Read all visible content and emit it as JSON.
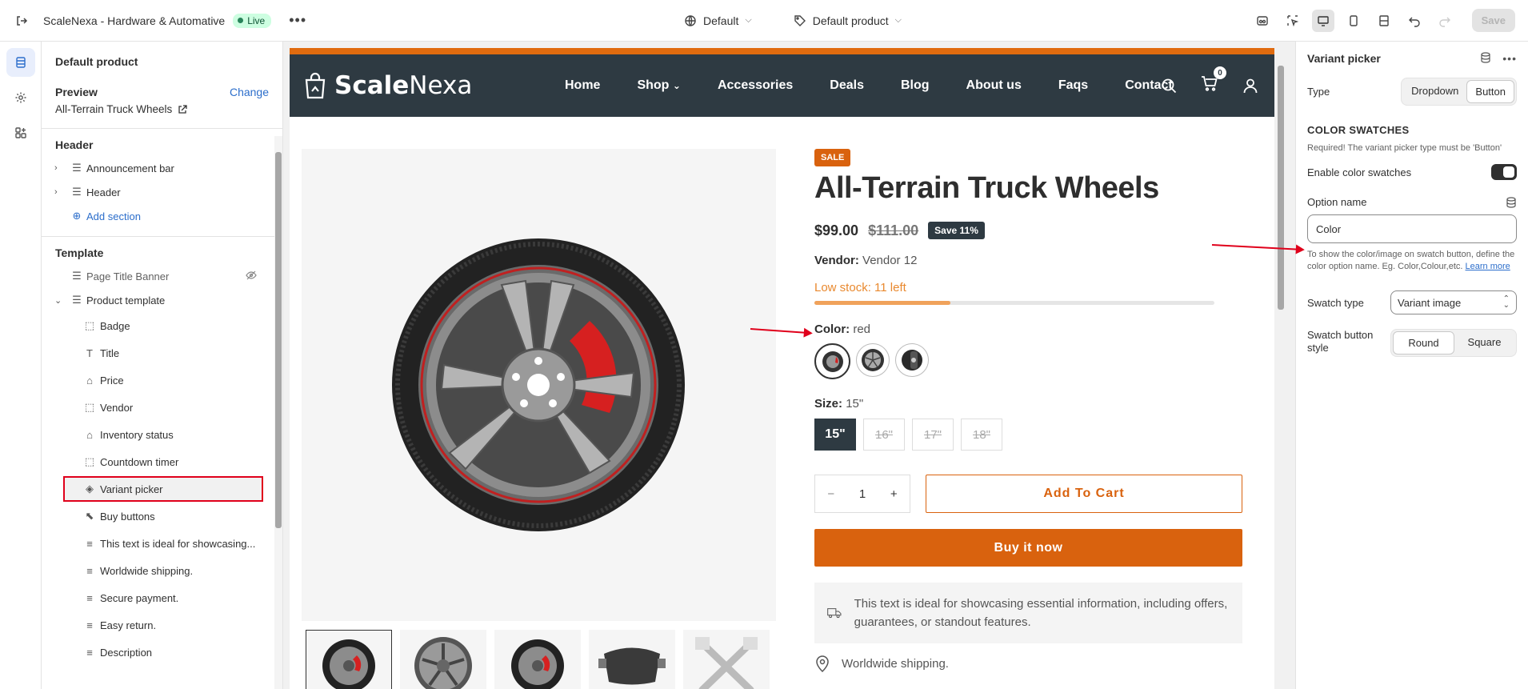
{
  "topbar": {
    "store_name": "ScaleNexa - Hardware & Automative",
    "status": "Live",
    "theme_select": "Default",
    "template_select": "Default product",
    "save_label": "Save"
  },
  "left_panel": {
    "title": "Default product",
    "preview_label": "Preview",
    "change_label": "Change",
    "preview_value": "All-Terrain Truck Wheels",
    "header_section": "Header",
    "header_items": [
      "Announcement bar",
      "Header"
    ],
    "add_section": "Add section",
    "template_section": "Template",
    "template_items": {
      "page_title_banner": "Page Title Banner",
      "product_template": "Product template"
    },
    "blocks": [
      "Badge",
      "Title",
      "Price",
      "Vendor",
      "Inventory status",
      "Countdown timer",
      "Variant picker",
      "Buy buttons",
      "This text is ideal for showcasing...",
      "Worldwide shipping.",
      "Secure payment.",
      "Easy return.",
      "Description"
    ],
    "block_icons": [
      "dashed-square-icon",
      "text-t-icon",
      "price-tag-icon",
      "dashed-square-icon",
      "store-icon",
      "dashed-square-icon",
      "variant-icon",
      "cursor-icon",
      "paragraph-icon",
      "paragraph-icon",
      "paragraph-icon",
      "paragraph-icon",
      "paragraph-icon"
    ]
  },
  "store": {
    "logo_bold": "Scale",
    "logo_light": "Nexa",
    "nav": [
      "Home",
      "Shop",
      "Accessories",
      "Deals",
      "Blog",
      "About us",
      "Faqs",
      "Contact"
    ],
    "cart_count": "0"
  },
  "product": {
    "badge": "SALE",
    "title": "All-Terrain Truck Wheels",
    "price": "$99.00",
    "compare_price": "$111.00",
    "save": "Save 11%",
    "vendor_label": "Vendor:",
    "vendor": "Vendor 12",
    "stock": "Low stock: 11 left",
    "stock_fraction": 0.34,
    "color_label": "Color:",
    "color_value": "red",
    "size_label": "Size:",
    "size_value": "15\"",
    "sizes": [
      "15\"",
      "16\"",
      "17\"",
      "18\""
    ],
    "qty": "1",
    "add_to_cart": "Add To Cart",
    "buy_now": "Buy it now",
    "info_text": "This text is ideal for showcasing essential information, including offers, guarantees, or standout features.",
    "shipping": "Worldwide shipping.",
    "accent_color": "#d9620e"
  },
  "right_panel": {
    "title": "Variant picker",
    "type_label": "Type",
    "type_options": [
      "Dropdown",
      "Button"
    ],
    "swatches_heading": "COLOR SWATCHES",
    "swatches_hint": "Required! The variant picker type must be 'Button'",
    "enable_swatches": "Enable color swatches",
    "option_name_label": "Option name",
    "option_name_value": "Color",
    "option_hint": "To show the color/image on swatch button, define the color option name. Eg. Color,Colour,etc.",
    "learn_more": "Learn more",
    "swatch_type_label": "Swatch type",
    "swatch_type_value": "Variant image",
    "swatch_style_label": "Swatch button style",
    "swatch_style_options": [
      "Round",
      "Square"
    ]
  }
}
